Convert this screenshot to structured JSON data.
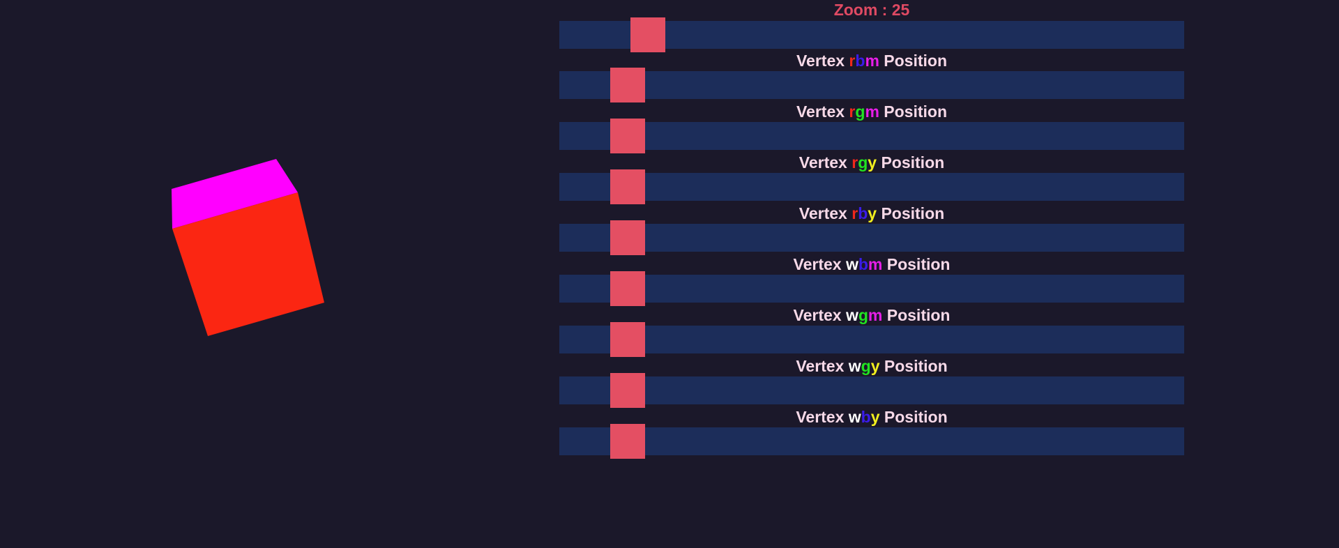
{
  "viewport": {
    "cube_top_color": "#ff00ff",
    "cube_front_color": "#fb2612"
  },
  "zoom": {
    "label": "Zoom : 25",
    "value": 25,
    "thumb_fraction": 0.12
  },
  "vertices": [
    {
      "prefix": "Vertex ",
      "letters": [
        {
          "ch": "r",
          "cls": "c-r"
        },
        {
          "ch": "b",
          "cls": "c-b"
        },
        {
          "ch": "m",
          "cls": "c-m"
        }
      ],
      "suffix": " Position",
      "thumb_fraction": 0.0857
    },
    {
      "prefix": "Vertex ",
      "letters": [
        {
          "ch": "r",
          "cls": "c-r"
        },
        {
          "ch": "g",
          "cls": "c-g"
        },
        {
          "ch": "m",
          "cls": "c-m"
        }
      ],
      "suffix": " Position",
      "thumb_fraction": 0.0857
    },
    {
      "prefix": "Vertex ",
      "letters": [
        {
          "ch": "r",
          "cls": "c-r"
        },
        {
          "ch": "g",
          "cls": "c-g"
        },
        {
          "ch": "y",
          "cls": "c-y"
        }
      ],
      "suffix": " Position",
      "thumb_fraction": 0.0857
    },
    {
      "prefix": "Vertex ",
      "letters": [
        {
          "ch": "r",
          "cls": "c-r"
        },
        {
          "ch": "b",
          "cls": "c-b"
        },
        {
          "ch": "y",
          "cls": "c-y"
        }
      ],
      "suffix": " Position",
      "thumb_fraction": 0.0857
    },
    {
      "prefix": "Vertex ",
      "letters": [
        {
          "ch": "w",
          "cls": "c-w"
        },
        {
          "ch": "b",
          "cls": "c-b"
        },
        {
          "ch": "m",
          "cls": "c-m"
        }
      ],
      "suffix": " Position",
      "thumb_fraction": 0.0857
    },
    {
      "prefix": "Vertex ",
      "letters": [
        {
          "ch": "w",
          "cls": "c-w"
        },
        {
          "ch": "g",
          "cls": "c-g"
        },
        {
          "ch": "m",
          "cls": "c-m"
        }
      ],
      "suffix": " Position",
      "thumb_fraction": 0.0857
    },
    {
      "prefix": "Vertex ",
      "letters": [
        {
          "ch": "w",
          "cls": "c-w"
        },
        {
          "ch": "g",
          "cls": "c-g"
        },
        {
          "ch": "y",
          "cls": "c-y"
        }
      ],
      "suffix": " Position",
      "thumb_fraction": 0.0857
    },
    {
      "prefix": "Vertex ",
      "letters": [
        {
          "ch": "w",
          "cls": "c-w"
        },
        {
          "ch": "b",
          "cls": "c-b"
        },
        {
          "ch": "y",
          "cls": "c-y"
        }
      ],
      "suffix": " Position",
      "thumb_fraction": 0.0857
    }
  ]
}
